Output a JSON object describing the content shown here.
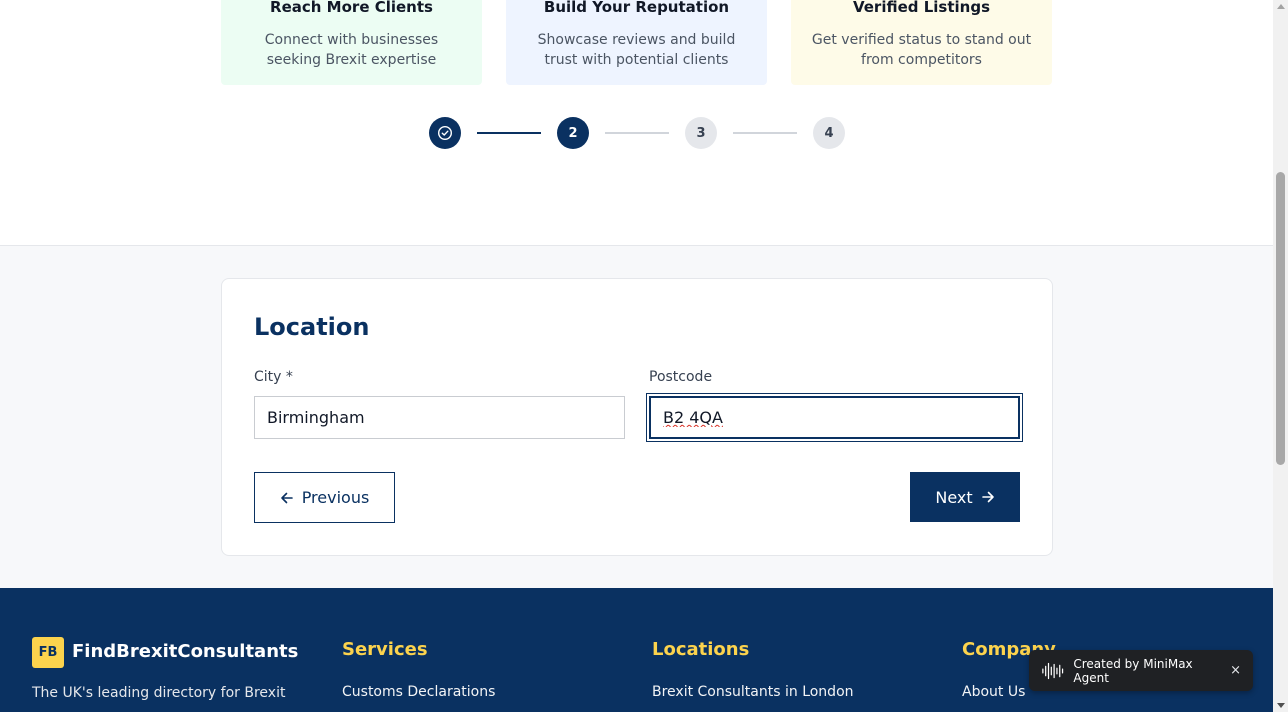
{
  "features": [
    {
      "title": "Reach More Clients",
      "description": "Connect with businesses seeking Brexit expertise"
    },
    {
      "title": "Build Your Reputation",
      "description": "Showcase reviews and build trust with potential clients"
    },
    {
      "title": "Verified Listings",
      "description": "Get verified status to stand out from competitors"
    }
  ],
  "stepper": {
    "current_step": 2,
    "steps": [
      {
        "label": "",
        "state": "completed",
        "icon": "check-circle-icon"
      },
      {
        "label": "2",
        "state": "active"
      },
      {
        "label": "3",
        "state": "pending"
      },
      {
        "label": "4",
        "state": "pending"
      }
    ]
  },
  "form": {
    "title": "Location",
    "city": {
      "label": "City *",
      "value": "Birmingham"
    },
    "postcode": {
      "label": "Postcode",
      "value": "B2 4QA"
    },
    "previous_label": "Previous",
    "next_label": "Next"
  },
  "footer": {
    "logo_initials": "FB",
    "brand_name": "FindBrexitConsultants",
    "tagline": "The UK's leading directory for Brexit",
    "columns": [
      {
        "title": "Services",
        "first_link": "Customs Declarations"
      },
      {
        "title": "Locations",
        "first_link": "Brexit Consultants in London"
      },
      {
        "title": "Company",
        "first_link": "About Us"
      }
    ]
  },
  "toast": {
    "text": "Created by MiniMax Agent",
    "close": "×"
  },
  "colors": {
    "primary": "#0a3161",
    "accent": "#fcd34d"
  }
}
